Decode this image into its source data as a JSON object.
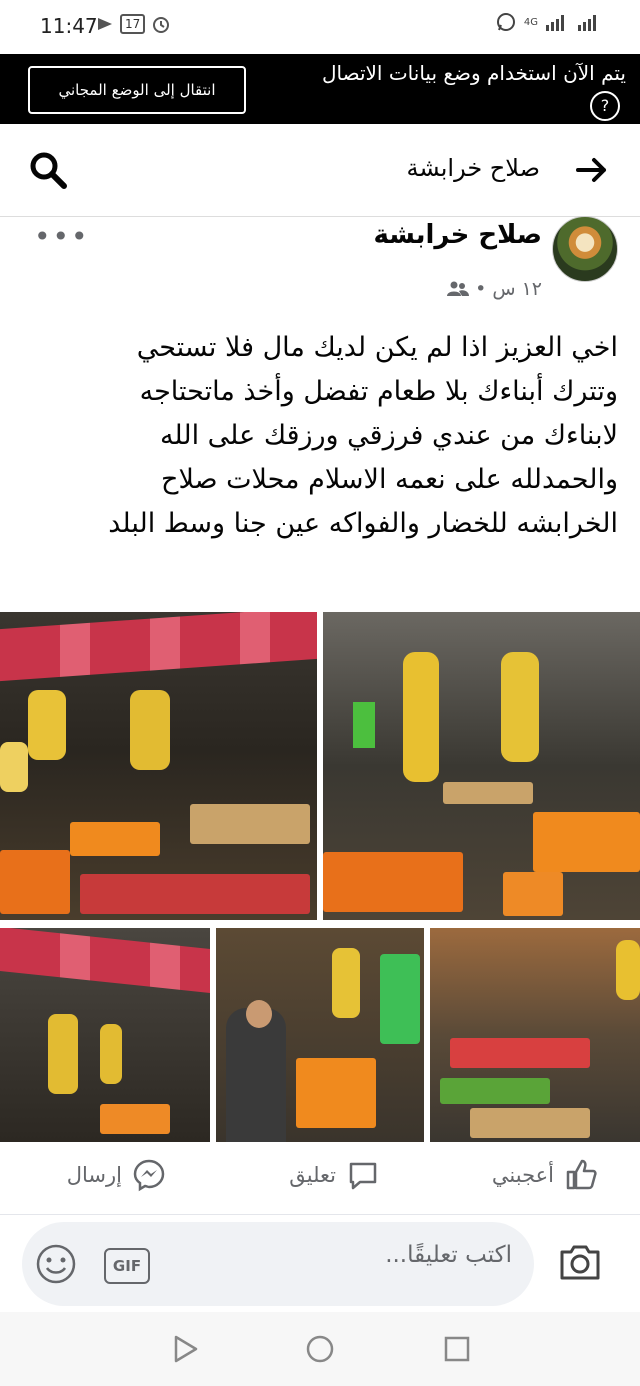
{
  "status_bar": {
    "time": "11:47",
    "battery": "17",
    "network": "4G"
  },
  "data_banner": {
    "message": "يتم الآن استخدام وضع بيانات الاتصال",
    "button_label": "انتقال إلى الوضع المجاني",
    "help_symbol": "?"
  },
  "header": {
    "title": "صلاح خرابشة"
  },
  "post": {
    "author": "صلاح خرابشة",
    "time": "١٢ س",
    "separator": "•",
    "text": "اخي العزيز اذا لم يكن لديك مال فلا تستحي\nوتترك أبناءك بلا طعام تفضل وأخذ ماتحتاجه\nلابناءك من عندي فرزقي ورزقك على الله\nوالحمدلله على نعمه الاسلام محلات صلاح\nالخرابشه للخضار والفواكه عين جنا وسط البلد",
    "more_symbol": "•••"
  },
  "actions": {
    "like": "أعجبني",
    "comment": "تعليق",
    "send": "إرسال"
  },
  "comment_bar": {
    "placeholder": "اكتب تعليقًا...",
    "gif": "GIF"
  },
  "icons": [
    "back-arrow-icon",
    "search-icon",
    "audience-friends-icon",
    "like-icon",
    "comment-icon",
    "messenger-icon",
    "camera-icon",
    "gif-icon",
    "smiley-icon",
    "nav-back-icon",
    "nav-home-icon",
    "nav-recents-icon"
  ],
  "colors": {
    "banner_bg": "#000000",
    "secondary_text": "#65676b",
    "comment_bg": "#f0f2f5"
  }
}
